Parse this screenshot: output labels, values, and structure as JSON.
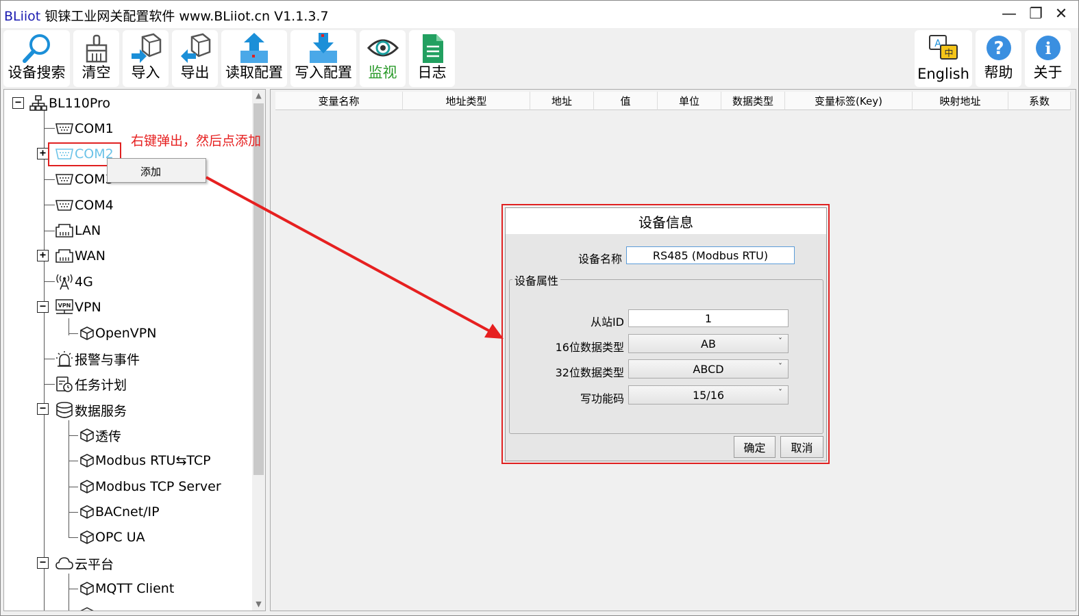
{
  "window": {
    "brand": "BLiiot",
    "title": "钡铼工业网关配置软件 www.BLiiot.cn V1.1.3.7",
    "minimize": "—",
    "restore": "❐",
    "close": "✕"
  },
  "toolbar": {
    "search": "设备搜索",
    "clear": "清空",
    "import": "导入",
    "export": "导出",
    "read_config": "读取配置",
    "write_config": "写入配置",
    "monitor": "监视",
    "log": "日志",
    "english": "English",
    "help": "帮助",
    "about": "关于",
    "monitor_color": "#2a9a2a"
  },
  "tree": {
    "root": "BL110Pro",
    "com1": "COM1",
    "com2": "COM2",
    "com3": "COM3",
    "com4": "COM4",
    "lan": "LAN",
    "wan": "WAN",
    "g4": "4G",
    "vpn": "VPN",
    "openvpn": "OpenVPN",
    "alarm": "报警与事件",
    "task": "任务计划",
    "data_service": "数据服务",
    "transparent": "透传",
    "modbus_rtu_tcp": "Modbus RTU⇆TCP",
    "modbus_tcp_server": "Modbus TCP Server",
    "bacnet": "BACnet/IP",
    "opcua": "OPC UA",
    "cloud": "云平台",
    "mqtt": "MQTT Client",
    "vpn_icon_text": "VPN",
    "selected_color": "#6cc3e8"
  },
  "context_menu": {
    "add": "添加"
  },
  "annotation": {
    "text": "右键弹出，然后点添加",
    "color": "#e62020"
  },
  "grid": {
    "columns": [
      "变量名称",
      "地址类型",
      "地址",
      "值",
      "单位",
      "数据类型",
      "变量标签(Key)",
      "映射地址",
      "系数"
    ]
  },
  "dialog": {
    "title": "设备信息",
    "name_label": "设备名称",
    "name_value": "RS485  (Modbus RTU)",
    "group_label": "设备属性",
    "slave_label": "从站ID",
    "slave_value": "1",
    "dt16_label": "16位数据类型",
    "dt16_value": "AB",
    "dt32_label": "32位数据类型",
    "dt32_value": "ABCD",
    "fc_label": "写功能码",
    "fc_value": "15/16",
    "ok": "确定",
    "cancel": "取消"
  }
}
